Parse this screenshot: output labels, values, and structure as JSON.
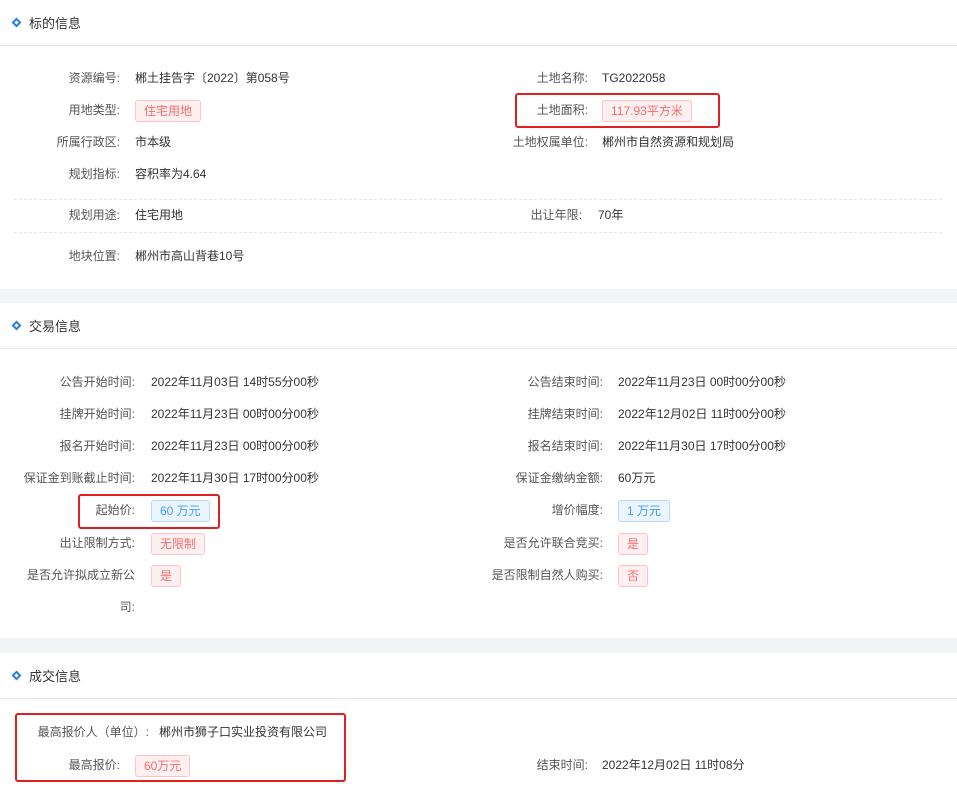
{
  "sections": {
    "target": {
      "title": "标的信息",
      "resource_no_label": "资源编号:",
      "resource_no": "郴土挂告字〔2022〕第058号",
      "land_name_label": "土地名称:",
      "land_name": "TG2022058",
      "land_type_label": "用地类型:",
      "land_type": "住宅用地",
      "land_area_label": "土地面积:",
      "land_area": "117.93平方米",
      "district_label": "所属行政区:",
      "district": "市本级",
      "owner_label": "土地权属单位:",
      "owner": "郴州市自然资源和规划局",
      "plan_index_label": "规划指标:",
      "plan_index": "容积率为4.64",
      "plan_use_label": "规划用途:",
      "plan_use": "住宅用地",
      "term_label": "出让年限:",
      "term": "70年",
      "location_label": "地块位置:",
      "location": "郴州市高山背巷10号"
    },
    "trade": {
      "title": "交易信息",
      "notice_start_label": "公告开始时间:",
      "notice_start": "2022年11月03日 14时55分00秒",
      "notice_end_label": "公告结束时间:",
      "notice_end": "2022年11月23日 00时00分00秒",
      "listing_start_label": "挂牌开始时间:",
      "listing_start": "2022年11月23日 00时00分00秒",
      "listing_end_label": "挂牌结束时间:",
      "listing_end": "2022年12月02日 11时00分00秒",
      "signup_start_label": "报名开始时间:",
      "signup_start": "2022年11月23日 00时00分00秒",
      "signup_end_label": "报名结束时间:",
      "signup_end": "2022年11月30日 17时00分00秒",
      "deposit_deadline_label": "保证金到账截止时间:",
      "deposit_deadline": "2022年11月30日 17时00分00秒",
      "deposit_amount_label": "保证金缴纳金额:",
      "deposit_amount": "60万元",
      "start_price_label": "起始价:",
      "start_price": "60 万元",
      "increment_label": "增价幅度:",
      "increment": "1 万元",
      "restriction_label": "出让限制方式:",
      "restriction": "无限制",
      "joint_bid_label": "是否允许联合竞买:",
      "joint_bid": "是",
      "new_company_label_1": "是否允许拟成立新公",
      "new_company_label_2": "司:",
      "new_company": "是",
      "natural_person_label": "是否限制自然人购买:",
      "natural_person": "否"
    },
    "deal": {
      "title": "成交信息",
      "top_bidder_label": "最高报价人（单位）:",
      "top_bidder": "郴州市狮子口实业投资有限公司",
      "top_price_label": "最高报价:",
      "top_price": "60万元",
      "end_time_label": "结束时间:",
      "end_time": "2022年12月02日 11时08分"
    }
  },
  "colors": {
    "accent": "#2f7fd8",
    "tag_red": "#f56c6c",
    "tag_blue": "#409eff",
    "highlight_box": "#e02020"
  }
}
